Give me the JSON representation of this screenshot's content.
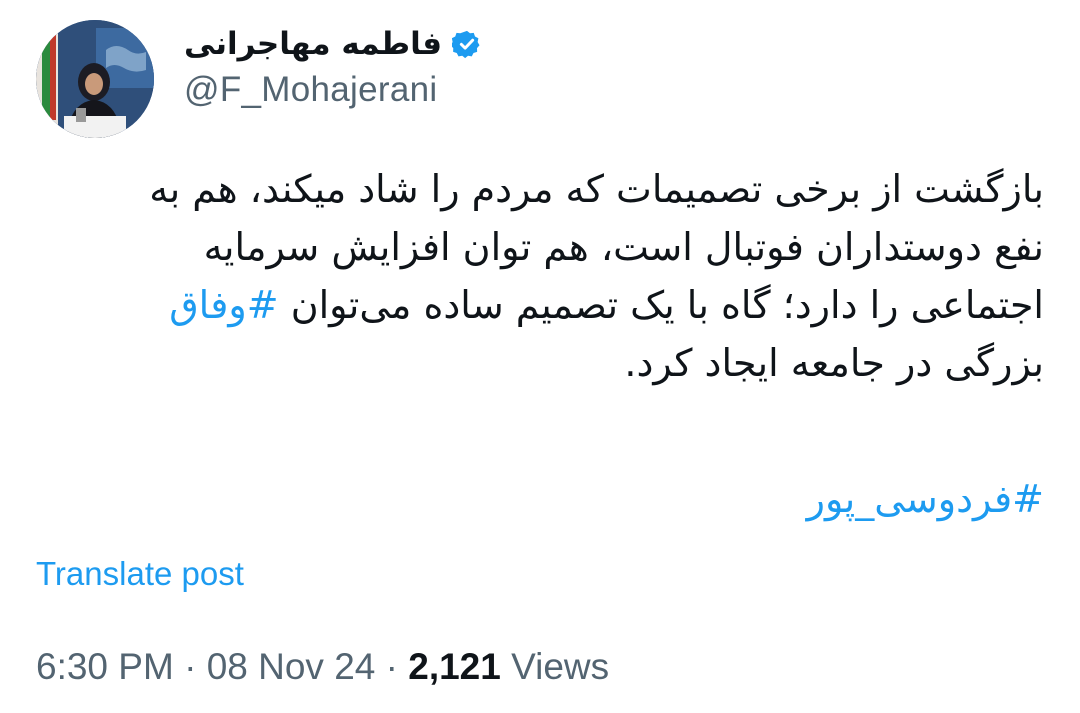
{
  "author": {
    "display_name": "فاطمه مهاجرانی",
    "handle": "@F_Mohajerani",
    "verified": true
  },
  "post": {
    "lines": [
      "بازگشت از برخی تصمیمات که مردم را شاد میکند، هم به",
      "نفع دوستداران فوتبال است، هم توان افزایش سرمایه"
    ],
    "line3_text": "اجتماعی را دارد؛ گاه با یک تصمیم ساده می‌توان ",
    "line3_hashtag": "#وفاق",
    "line4": "بزرگی در جامعه ایجاد کرد.",
    "hashtag_line": "#فردوسی_پور"
  },
  "actions": {
    "translate_label": "Translate post"
  },
  "meta": {
    "time": "6:30 PM",
    "sep1": " · ",
    "date": "08 Nov 24",
    "sep2": " · ",
    "views_count": "2,121",
    "views_label": " Views"
  },
  "colors": {
    "link": "#1d9bf0",
    "text": "#0f1419",
    "muted": "#536471",
    "verified": "#1d9bf0"
  }
}
